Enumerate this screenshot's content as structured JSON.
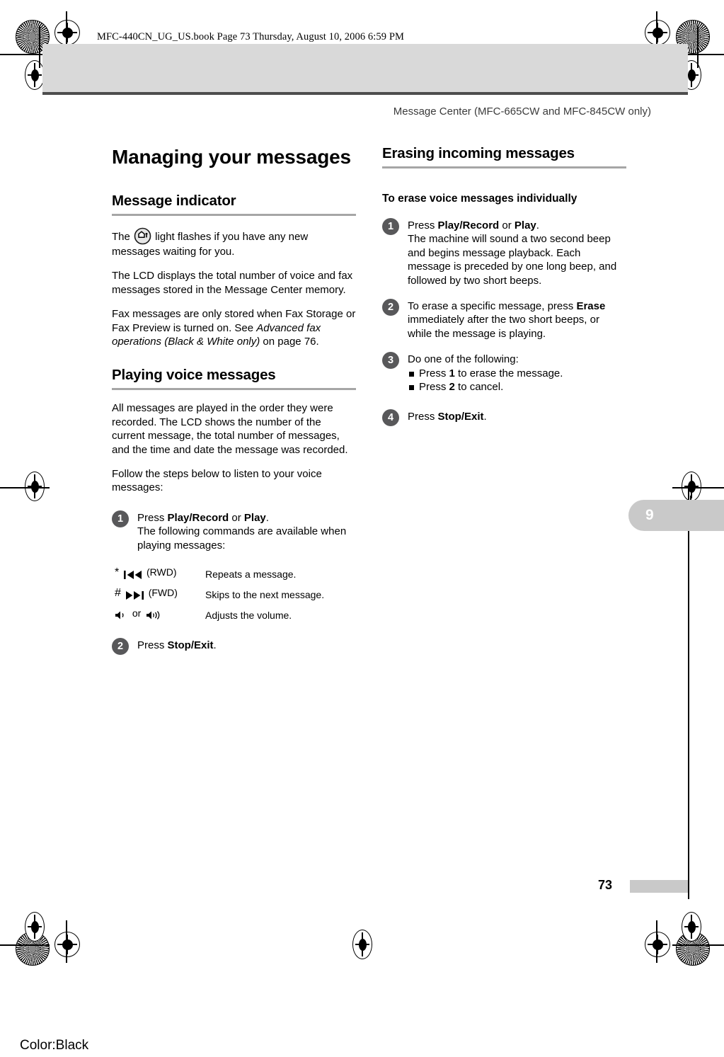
{
  "print_marks": {
    "color_label": "Color:Black"
  },
  "header": {
    "book_line": "MFC-440CN_UG_US.book  Page 73  Thursday, August 10, 2006  6:59 PM",
    "running_head": "Message Center (MFC-665CW and MFC-845CW only)"
  },
  "chapter_tab": {
    "number": "9"
  },
  "footer": {
    "page_number": "73"
  },
  "left_column": {
    "chapter_title": "Managing your messages",
    "section1": {
      "heading": "Message indicator",
      "para1_before_icon": "The ",
      "icon_name": "message-indicator-led",
      "para1_after_icon": " light flashes if you have any new messages waiting for you.",
      "para2": "The LCD displays the total number of voice and fax messages stored in the Message Center memory.",
      "para3_a": "Fax messages are only stored when Fax Storage or Fax Preview is turned on. See ",
      "para3_italic": "Advanced fax operations (Black & White only)",
      "para3_b": " on page 76."
    },
    "section2": {
      "heading": "Playing voice messages",
      "para1": "All messages are played in the order they were recorded. The LCD shows the number of the current message, the total number of messages, and the time and date the message was recorded.",
      "para2": "Follow the steps below to listen to your voice messages:",
      "steps": [
        {
          "number": "1",
          "line1_a": "Press ",
          "line1_b1": "Play/Record",
          "line1_c": " or ",
          "line1_b2": "Play",
          "line1_d": ".",
          "line2": "The following commands are available when playing messages:"
        },
        {
          "number": "2",
          "line1_a": "Press ",
          "line1_b1": "Stop/Exit",
          "line1_d": "."
        }
      ],
      "command_table": [
        {
          "key_prefix": "*",
          "key_icon": "rewind-icon",
          "key_label": "(RWD)",
          "description": "Repeats a message."
        },
        {
          "key_prefix": "#",
          "key_icon": "fast-forward-icon",
          "key_label": "(FWD)",
          "description": "Skips to the next message."
        },
        {
          "key_prefix": "",
          "key_icon": "volume-low-icon",
          "key_label": "or",
          "key_icon2": "volume-high-icon",
          "description": "Adjusts the volume."
        }
      ]
    }
  },
  "right_column": {
    "section1": {
      "heading": "Erasing incoming messages",
      "subheading": "To erase voice messages individually",
      "steps": [
        {
          "number": "1",
          "line1_a": "Press ",
          "line1_b1": "Play/Record",
          "line1_c": " or ",
          "line1_b2": "Play",
          "line1_d": ".",
          "line2": "The machine will sound a two second beep and begins message playback. Each message is preceded by one long beep, and followed by two short beeps."
        },
        {
          "number": "2",
          "text_a": "To erase a specific message, press ",
          "text_b": "Erase",
          "text_c": " immediately after the two short beeps, or while the message is playing."
        },
        {
          "number": "3",
          "text_a": "Do one of the following:",
          "bullets": [
            {
              "a": "Press ",
              "b": "1",
              "c": " to erase the message."
            },
            {
              "a": "Press ",
              "b": "2",
              "c": " to cancel."
            }
          ]
        },
        {
          "number": "4",
          "line1_a": "Press ",
          "line1_b1": "Stop/Exit",
          "line1_d": "."
        }
      ]
    }
  }
}
